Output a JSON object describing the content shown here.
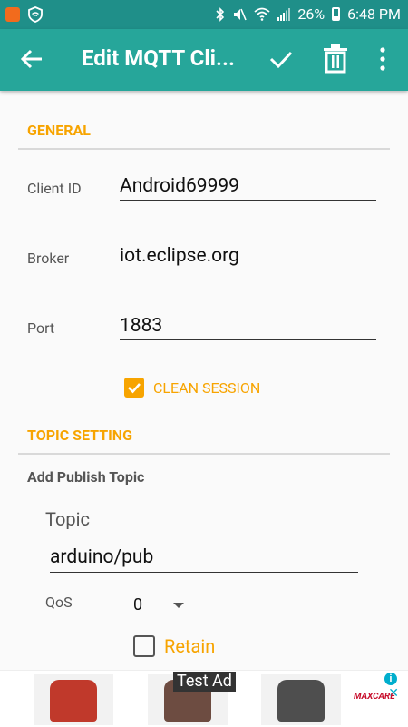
{
  "status_bar": {
    "battery": "26%",
    "time": "6:48 PM"
  },
  "toolbar": {
    "title": "Edit MQTT Cli..."
  },
  "general": {
    "header": "GENERAL",
    "client_id_label": "Client ID",
    "client_id_value": "Android69999",
    "broker_label": "Broker",
    "broker_value": "iot.eclipse.org",
    "port_label": "Port",
    "port_value": "1883",
    "clean_session_label": "CLEAN SESSION",
    "clean_session_checked": true
  },
  "topic_setting": {
    "header": "TOPIC SETTING",
    "add_publish_label": "Add Publish Topic",
    "topic_label": "Topic",
    "topic_value": "arduino/pub",
    "qos_label": "QoS",
    "qos_value": "0",
    "retain_label": "Retain",
    "retain_checked": false
  },
  "ad": {
    "badge": "Test Ad",
    "info": "i",
    "close": "✕",
    "brand": "MAXCARE"
  },
  "colors": {
    "status_bar": "#1f8f89",
    "toolbar": "#26a69a",
    "accent": "#f7a400"
  }
}
